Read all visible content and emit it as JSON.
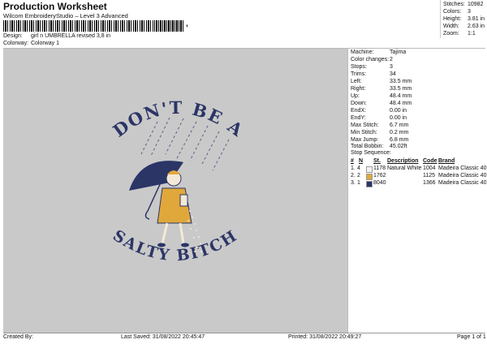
{
  "header": {
    "title": "Production Worksheet",
    "subtitle": "Wilcom EmbroideryStudio – Level 3 Advanced",
    "barcode_suffix": ","
  },
  "meta": {
    "design_label": "Design:",
    "design_value": "girl n UMBRELLA revised 3,8 in",
    "colorway_label": "Colorway:",
    "colorway_value": "Colorway 1"
  },
  "summary": [
    {
      "label": "Stitches:",
      "value": "10982"
    },
    {
      "label": "Colors:",
      "value": "3"
    },
    {
      "label": "Height:",
      "value": "3.81 in"
    },
    {
      "label": "Width:",
      "value": "2.63 in"
    },
    {
      "label": "Zoom:",
      "value": "1:1"
    }
  ],
  "artwork": {
    "top_text": "DON'T BE A",
    "bottom_text": "SALTY BITCH"
  },
  "info": [
    {
      "label": "Machine:",
      "value": "Tajima"
    },
    {
      "label": "Color changes:",
      "value": "2"
    },
    {
      "label": "Stops:",
      "value": "3"
    },
    {
      "label": "Trims:",
      "value": "34"
    },
    {
      "label": "Left:",
      "value": "33.5 mm"
    },
    {
      "label": "Right:",
      "value": "33.5 mm"
    },
    {
      "label": "Up:",
      "value": "48.4 mm"
    },
    {
      "label": "Down:",
      "value": "48.4 mm"
    },
    {
      "label": "EndX:",
      "value": "0.00 in"
    },
    {
      "label": "EndY:",
      "value": "0.00 in"
    },
    {
      "label": "Max Stitch:",
      "value": "6.7 mm"
    },
    {
      "label": "Min Stitch:",
      "value": "0.2 mm"
    },
    {
      "label": "Max Jump:",
      "value": "6.8 mm"
    },
    {
      "label": "Total Bobbin:",
      "value": "45.02ft"
    }
  ],
  "stop_sequence": {
    "title": "Stop Sequence:",
    "headers": [
      "#",
      "N",
      "St.",
      "Description",
      "Code",
      "Brand"
    ],
    "rows": [
      {
        "num": "1.",
        "n": "4",
        "st": "1178",
        "desc": "Natural White",
        "code": "1004",
        "brand": "Madeira Classic 40",
        "color": "#f2f2f2"
      },
      {
        "num": "2.",
        "n": "2",
        "st": "1762",
        "desc": "",
        "code": "1125",
        "brand": "Madeira Classic 40",
        "color": "#e0a83a"
      },
      {
        "num": "3.",
        "n": "1",
        "st": "8040",
        "desc": "",
        "code": "1366",
        "brand": "Madeira Classic 40",
        "color": "#2b3566"
      }
    ]
  },
  "footer": {
    "created": "Created By:",
    "saved": "Last Saved: 31/08/2022 20:45:47",
    "printed": "Printed: 31/08/2022 20:49:27",
    "page": "Page 1 of 1"
  },
  "colors": {
    "navy": "#2b3566",
    "yellow": "#e0a83a",
    "background": "#c9c9c9"
  }
}
